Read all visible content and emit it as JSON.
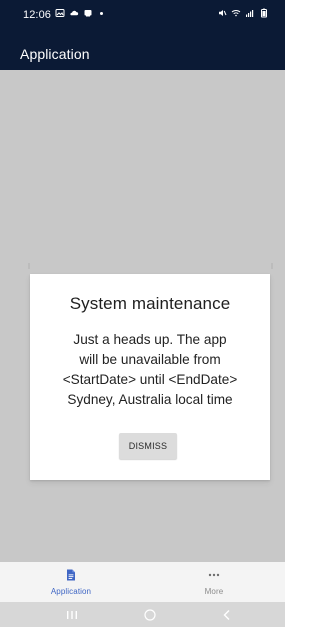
{
  "status_bar": {
    "time": "12:06",
    "left_icons": [
      "image-icon",
      "cloud-icon",
      "notification-icon",
      "dot-icon"
    ],
    "right_icons": [
      "mute-icon",
      "wifi-icon",
      "signal-icon",
      "battery-icon"
    ]
  },
  "app_bar": {
    "title": "Application"
  },
  "dialog": {
    "title": "System maintenance",
    "lines": [
      "Just a heads up. The app",
      "will be unavailable from",
      "<StartDate>  until <EndDate>",
      "Sydney, Australia local time"
    ],
    "button_label": "DISMISS"
  },
  "bottom_nav": {
    "items": [
      {
        "label": "Application",
        "icon": "document-icon",
        "active": true
      },
      {
        "label": "More",
        "icon": "more-icon",
        "active": false
      }
    ]
  },
  "system_nav": {
    "icons": [
      "recents-icon",
      "home-icon",
      "back-icon"
    ]
  },
  "colors": {
    "top_bar": "#0b1a35",
    "overlay": "#c8c8c8",
    "dialog_bg": "#ffffff",
    "button_bg": "#dcdcdc",
    "active_nav": "#3f66c4",
    "inactive_nav": "#8b8b8b",
    "bottom_nav_bg": "#f4f4f4",
    "system_nav_bg": "#d7d7d7"
  }
}
